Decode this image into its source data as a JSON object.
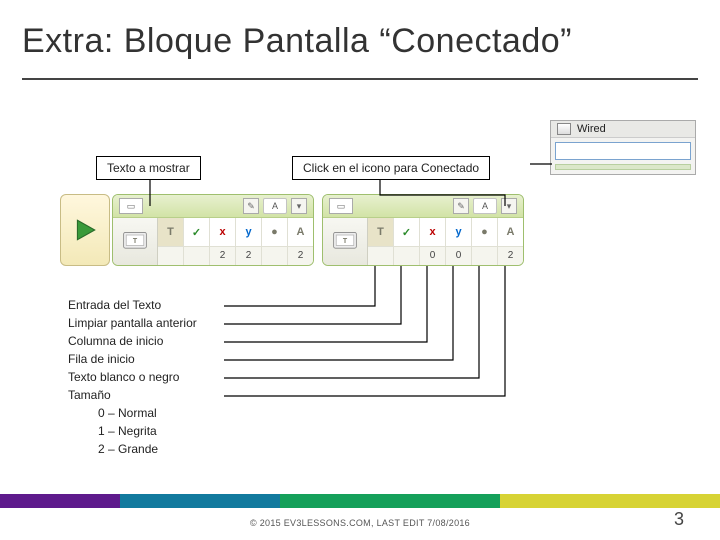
{
  "title": "Extra: Bloque Pantalla “Conectado”",
  "wired": {
    "label": "Wired"
  },
  "labels": {
    "texto": "Texto a mostrar",
    "click": "Click en el icono para Conectado"
  },
  "blocks": {
    "a": {
      "topLabel": "A",
      "params": {
        "text": {
          "icon": "T",
          "val": ""
        },
        "clear": {
          "icon": "✓",
          "val": ""
        },
        "col": {
          "icon": "2",
          "val": "2"
        },
        "row": {
          "icon": "2",
          "val": "2"
        },
        "color": {
          "icon": "●",
          "val": ""
        },
        "size": {
          "icon": "2",
          "val": "2"
        }
      }
    },
    "b": {
      "topLabel": "A",
      "params": {
        "text": {
          "icon": "T",
          "val": ""
        },
        "clear": {
          "icon": "✓",
          "val": ""
        },
        "col": {
          "icon": "0",
          "val": "0"
        },
        "row": {
          "icon": "0",
          "val": "0"
        },
        "color": {
          "icon": "●",
          "val": ""
        },
        "size": {
          "icon": "2",
          "val": "2"
        }
      }
    }
  },
  "legend": {
    "l1": "Entrada del Texto",
    "l2": "Limpiar pantalla anterior",
    "l3": "Columna de inicio",
    "l4": "Fila de inicio",
    "l5": "Texto blanco o negro",
    "l6": "Tamaño",
    "l7": "0 – Normal",
    "l8": "1 – Negrita",
    "l9": "2 – Grande"
  },
  "footer": "© 2015 EV3LESSONS.COM, LAST EDIT 7/08/2016",
  "page": "3"
}
